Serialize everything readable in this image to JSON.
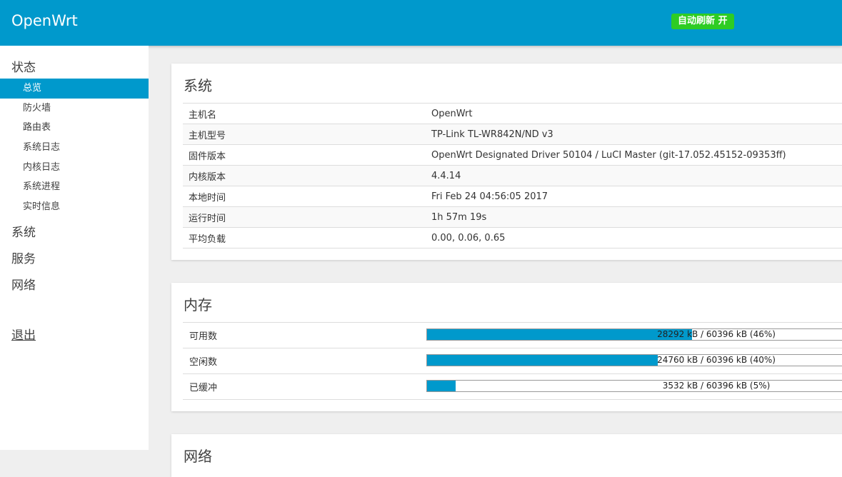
{
  "header": {
    "brand": "OpenWrt",
    "refresh_label": "自动刷新 开"
  },
  "sidebar": {
    "status": "状态",
    "status_items": [
      "总览",
      "防火墙",
      "路由表",
      "系统日志",
      "内核日志",
      "系统进程",
      "实时信息"
    ],
    "system": "系统",
    "services": "服务",
    "network": "网络",
    "logout": "退出"
  },
  "system_card": {
    "title": "系统",
    "rows": [
      {
        "key": "主机名",
        "value": "OpenWrt"
      },
      {
        "key": "主机型号",
        "value": "TP-Link TL-WR842N/ND v3"
      },
      {
        "key": "固件版本",
        "value": "OpenWrt Designated Driver 50104 / LuCI Master (git-17.052.45152-09353ff)"
      },
      {
        "key": "内核版本",
        "value": "4.4.14"
      },
      {
        "key": "本地时间",
        "value": "Fri Feb 24 04:56:05 2017"
      },
      {
        "key": "运行时间",
        "value": "1h 57m 19s"
      },
      {
        "key": "平均负载",
        "value": "0.00, 0.06, 0.65"
      }
    ]
  },
  "memory_card": {
    "title": "内存",
    "rows": [
      {
        "key": "可用数",
        "text": "28292 kB / 60396 kB (46%)",
        "percent": 46
      },
      {
        "key": "空闲数",
        "text": "24760 kB / 60396 kB (40%)",
        "percent": 40
      },
      {
        "key": "已缓冲",
        "text": "3532 kB / 60396 kB (5%)",
        "percent": 5
      }
    ]
  },
  "network_card": {
    "title": "网络"
  },
  "colors": {
    "accent": "#0099cc",
    "refresh_green": "#2ecc23"
  }
}
